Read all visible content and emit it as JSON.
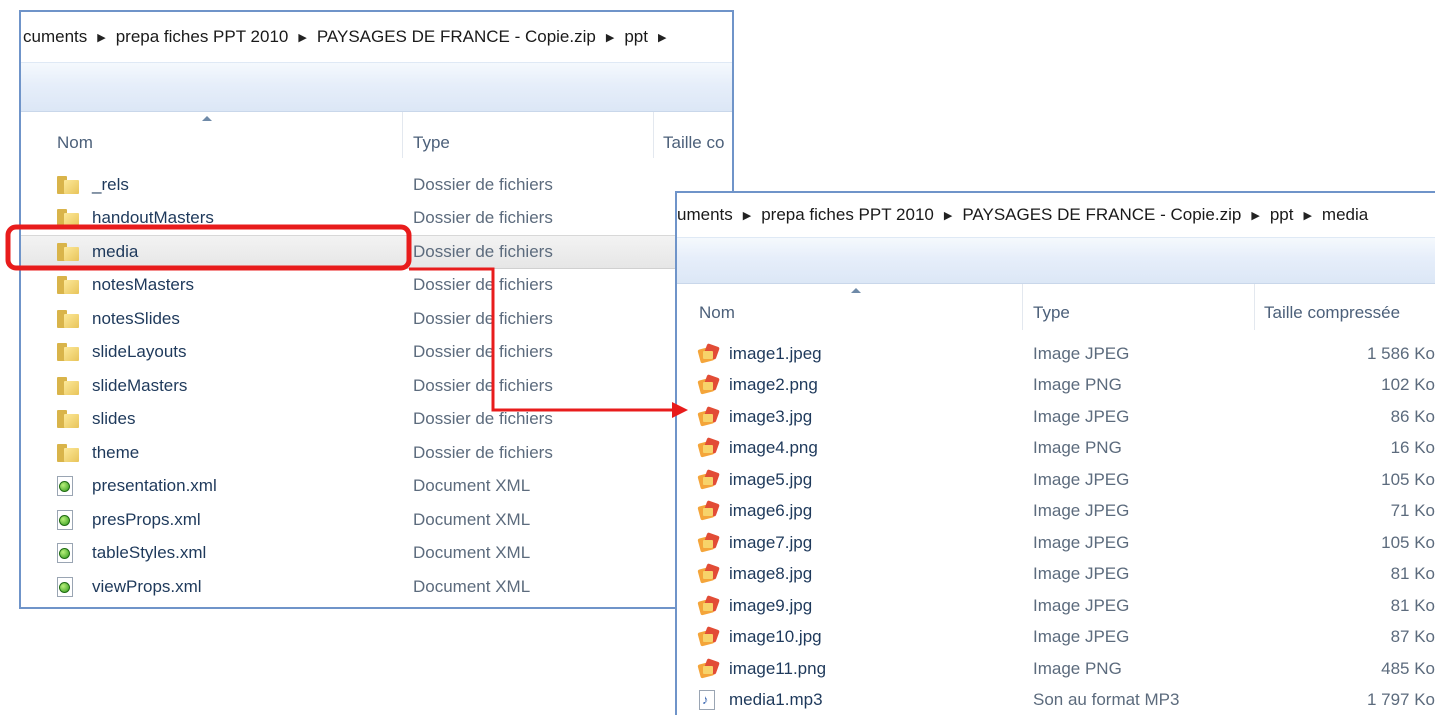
{
  "window_back": {
    "breadcrumb": [
      "cuments",
      "prepa fiches PPT 2010",
      "PAYSAGES DE FRANCE - Copie.zip",
      "ppt"
    ],
    "columns": {
      "name": "Nom",
      "type": "Type",
      "size": "Taille co"
    },
    "rows": [
      {
        "name": "_rels",
        "type": "Dossier de fichiers",
        "icon": "folder-icon"
      },
      {
        "name": "handoutMasters",
        "type": "Dossier de fichiers",
        "icon": "folder-icon"
      },
      {
        "name": "media",
        "type": "Dossier de fichiers",
        "icon": "folder-icon",
        "selected": true
      },
      {
        "name": "notesMasters",
        "type": "Dossier de fichiers",
        "icon": "folder-icon"
      },
      {
        "name": "notesSlides",
        "type": "Dossier de fichiers",
        "icon": "folder-icon"
      },
      {
        "name": "slideLayouts",
        "type": "Dossier de fichiers",
        "icon": "folder-icon"
      },
      {
        "name": "slideMasters",
        "type": "Dossier de fichiers",
        "icon": "folder-icon"
      },
      {
        "name": "slides",
        "type": "Dossier de fichiers",
        "icon": "folder-icon"
      },
      {
        "name": "theme",
        "type": "Dossier de fichiers",
        "icon": "folder-icon"
      },
      {
        "name": "presentation.xml",
        "type": "Document XML",
        "icon": "xml-file-icon"
      },
      {
        "name": "presProps.xml",
        "type": "Document XML",
        "icon": "xml-file-icon"
      },
      {
        "name": "tableStyles.xml",
        "type": "Document XML",
        "icon": "xml-file-icon"
      },
      {
        "name": "viewProps.xml",
        "type": "Document XML",
        "icon": "xml-file-icon"
      }
    ]
  },
  "window_front": {
    "breadcrumb": [
      "uments",
      "prepa fiches PPT 2010",
      "PAYSAGES DE FRANCE - Copie.zip",
      "ppt",
      "media"
    ],
    "columns": {
      "name": "Nom",
      "type": "Type",
      "size": "Taille compressée"
    },
    "rows": [
      {
        "name": "image1.jpeg",
        "type": "Image JPEG",
        "size": "1 586 Ko",
        "icon": "image-file-icon"
      },
      {
        "name": "image2.png",
        "type": "Image PNG",
        "size": "102 Ko",
        "icon": "image-file-icon"
      },
      {
        "name": "image3.jpg",
        "type": "Image JPEG",
        "size": "86 Ko",
        "icon": "image-file-icon"
      },
      {
        "name": "image4.png",
        "type": "Image PNG",
        "size": "16 Ko",
        "icon": "image-file-icon"
      },
      {
        "name": "image5.jpg",
        "type": "Image JPEG",
        "size": "105 Ko",
        "icon": "image-file-icon"
      },
      {
        "name": "image6.jpg",
        "type": "Image JPEG",
        "size": "71 Ko",
        "icon": "image-file-icon"
      },
      {
        "name": "image7.jpg",
        "type": "Image JPEG",
        "size": "105 Ko",
        "icon": "image-file-icon"
      },
      {
        "name": "image8.jpg",
        "type": "Image JPEG",
        "size": "81 Ko",
        "icon": "image-file-icon"
      },
      {
        "name": "image9.jpg",
        "type": "Image JPEG",
        "size": "81 Ko",
        "icon": "image-file-icon"
      },
      {
        "name": "image10.jpg",
        "type": "Image JPEG",
        "size": "87 Ko",
        "icon": "image-file-icon"
      },
      {
        "name": "image11.png",
        "type": "Image PNG",
        "size": "485 Ko",
        "icon": "image-file-icon"
      },
      {
        "name": "media1.mp3",
        "type": "Son au format MP3",
        "size": "1 797 Ko",
        "icon": "audio-file-icon"
      }
    ]
  },
  "annotation": {
    "highlight_color": "#e81c1c"
  }
}
